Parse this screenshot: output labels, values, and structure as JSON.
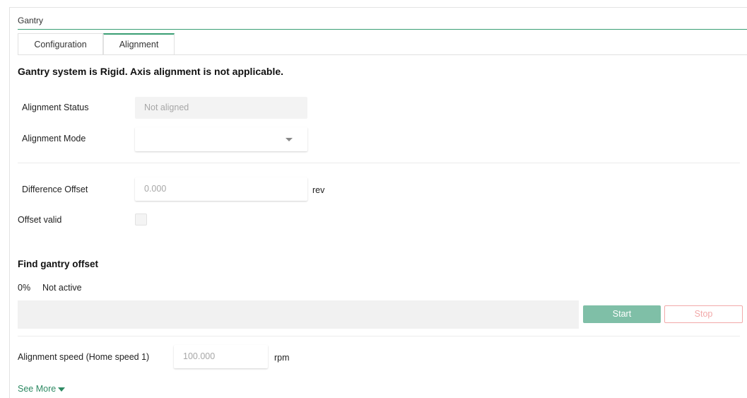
{
  "panel": {
    "title": "Gantry"
  },
  "tabs": [
    {
      "label": "Configuration",
      "active": false
    },
    {
      "label": "Alignment",
      "active": true
    }
  ],
  "notice": "Gantry system is Rigid. Axis alignment is not applicable.",
  "alignment": {
    "status_label": "Alignment Status",
    "status_value": "Not aligned",
    "mode_label": "Alignment Mode",
    "mode_value": ""
  },
  "offset": {
    "difference_label": "Difference Offset",
    "difference_value": "0.000",
    "difference_unit": "rev",
    "valid_label": "Offset valid",
    "valid_checked": false
  },
  "find_offset": {
    "heading": "Find gantry offset",
    "progress_text": "0%",
    "progress_fraction": 0,
    "state": "Not active",
    "start_label": "Start",
    "stop_label": "Stop"
  },
  "speed": {
    "label": "Alignment speed (Home speed 1)",
    "value": "100.000",
    "unit": "rpm"
  },
  "see_more": {
    "label": "See More",
    "icon": "caret-down-icon"
  },
  "colors": {
    "accent": "#3a9e74",
    "start_button": "#7fbfa7",
    "stop_border": "#f2a9a9",
    "disabled_text": "#a7a7a7"
  }
}
